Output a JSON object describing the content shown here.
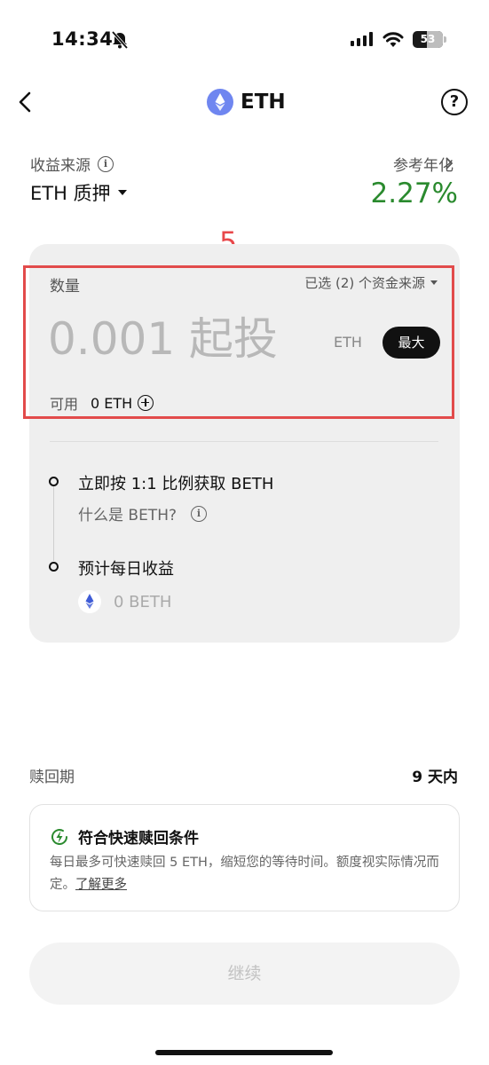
{
  "status_bar": {
    "time": "14:34",
    "battery": "53"
  },
  "nav": {
    "title": "ETH"
  },
  "yield_source": {
    "label": "收益来源",
    "value": "ETH 质押"
  },
  "apr": {
    "label": "参考年化",
    "value": "2.27%"
  },
  "annotation": {
    "number": "5"
  },
  "amount": {
    "label": "数量",
    "fund_source": "已选 (2) 个资金来源",
    "placeholder": "0.001 起投",
    "unit": "ETH",
    "max_label": "最大",
    "available_label": "可用",
    "available_value": "0 ETH"
  },
  "steps": {
    "step1_title": "立即按 1:1 比例获取 BETH",
    "step1_link": "什么是 BETH?",
    "step2_title": "预计每日收益",
    "beth_value": "0 BETH"
  },
  "redemption": {
    "label": "赎回期",
    "value": "9 天内"
  },
  "fast_redeem": {
    "title": "符合快速赎回条件",
    "desc": "每日最多可快速赎回 5 ETH，缩短您的等待时间。额度视实际情况而定。",
    "link": "了解更多"
  },
  "continue_label": "继续",
  "colors": {
    "apr_green": "#2a8a2e",
    "highlight_red": "#e24b4b",
    "eth_blue": "#6f86f0"
  }
}
